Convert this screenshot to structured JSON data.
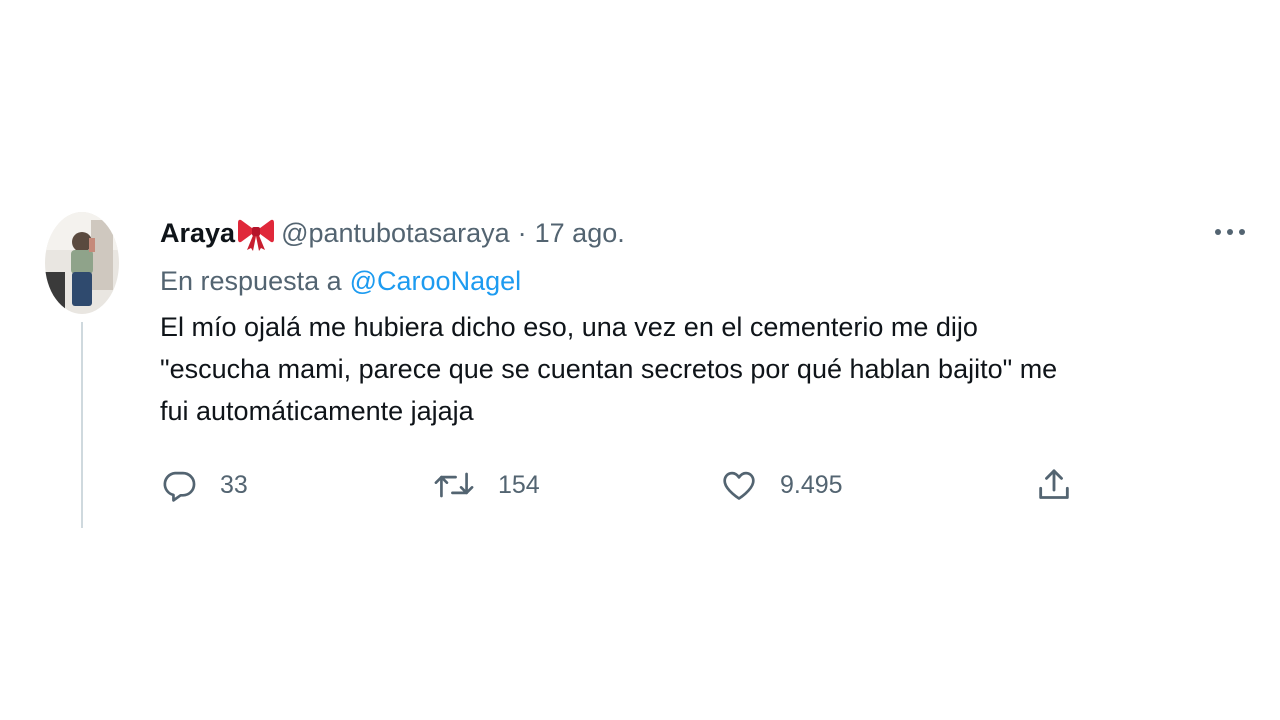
{
  "tweet": {
    "display_name": "Araya",
    "handle": "@pantubotasaraya",
    "separator": "·",
    "date": "17 ago.",
    "reply_prefix": "En respuesta a",
    "reply_to": "@CarooNagel",
    "text_lines": [
      "El mío ojalá me hubiera dicho eso, una vez en el cementerio me dijo",
      "\"escucha mami, parece que se cuentan secretos por qué hablan bajito\" me",
      "fui automáticamente jajaja"
    ]
  },
  "actions": {
    "replies": "33",
    "retweets": "154",
    "likes": "9.495"
  },
  "icons": {
    "name_emoji": "ribbon-bow-icon",
    "more": "more-dots-icon",
    "reply": "reply-bubble-icon",
    "retweet": "retweet-icon",
    "like": "heart-icon",
    "share": "share-icon"
  },
  "colors": {
    "text_primary": "#0f1419",
    "text_secondary": "#536471",
    "link": "#1d9bf0",
    "thread_line": "#cfd9de",
    "bow": "#e0283a"
  }
}
